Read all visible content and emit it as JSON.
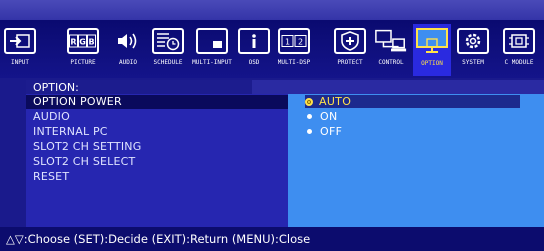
{
  "toolbar": {
    "items": [
      {
        "label": "INPUT",
        "icon": "input-icon"
      },
      {
        "label": "PICTURE",
        "icon": "picture-rgb-icon"
      },
      {
        "label": "AUDIO",
        "icon": "speaker-icon"
      },
      {
        "label": "SCHEDULE",
        "icon": "schedule-clock-icon"
      },
      {
        "label": "MULTI-INPUT",
        "icon": "multi-input-icon"
      },
      {
        "label": "OSD",
        "icon": "info-icon"
      },
      {
        "label": "MULTI-DSP",
        "icon": "multi-display-icon"
      },
      {
        "label": "PROTECT",
        "icon": "shield-icon"
      },
      {
        "label": "CONTROL",
        "icon": "computer-icon"
      },
      {
        "label": "OPTION",
        "icon": "option-monitor-icon",
        "active": true
      },
      {
        "label": "SYSTEM",
        "icon": "gear-icon"
      },
      {
        "label": "C MODULE",
        "icon": "compute-module-icon"
      }
    ],
    "active_label": "OPTION"
  },
  "menu": {
    "title": "OPTION:",
    "items": [
      {
        "label": "OPTION POWER",
        "selected": true
      },
      {
        "label": "AUDIO"
      },
      {
        "label": "INTERNAL PC"
      },
      {
        "label": "SLOT2 CH SETTING"
      },
      {
        "label": "SLOT2 CH SELECT"
      },
      {
        "label": "RESET"
      }
    ]
  },
  "options": {
    "items": [
      {
        "label": "AUTO",
        "selected": true
      },
      {
        "label": "ON"
      },
      {
        "label": "OFF"
      }
    ]
  },
  "footer": {
    "hint": "△▽:Choose (SET):Decide (EXIT):Return (MENU):Close"
  },
  "colors": {
    "background": "#1a1a8c",
    "option_panel": "#3e8ef0",
    "highlight": "#ffe24a"
  }
}
